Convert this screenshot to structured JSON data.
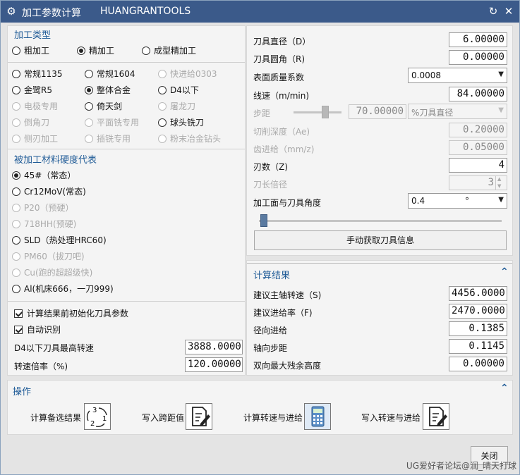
{
  "window": {
    "title": "加工参数计算",
    "brand": "HUANGRANTOOLS"
  },
  "machining_type": {
    "title": "加工类型",
    "options": [
      "粗加工",
      "精加工",
      "成型精加工"
    ],
    "selected": "精加工"
  },
  "tool_type": {
    "options": [
      {
        "label": "常规1135",
        "checked": false,
        "enabled": true
      },
      {
        "label": "常规1604",
        "checked": false,
        "enabled": true
      },
      {
        "label": "快进给0303",
        "checked": false,
        "enabled": false
      },
      {
        "label": "金鹭R5",
        "checked": false,
        "enabled": true
      },
      {
        "label": "整体合金",
        "checked": true,
        "enabled": true
      },
      {
        "label": "D4以下",
        "checked": false,
        "enabled": true
      },
      {
        "label": "电极专用",
        "checked": false,
        "enabled": false
      },
      {
        "label": "倚天剑",
        "checked": false,
        "enabled": true
      },
      {
        "label": "屠龙刀",
        "checked": false,
        "enabled": false
      },
      {
        "label": "倒角刀",
        "checked": false,
        "enabled": false
      },
      {
        "label": "平面铣专用",
        "checked": false,
        "enabled": false
      },
      {
        "label": "球头铣刀",
        "checked": false,
        "enabled": true
      },
      {
        "label": "侧刃加工",
        "checked": false,
        "enabled": false
      },
      {
        "label": "插铣专用",
        "checked": false,
        "enabled": false
      },
      {
        "label": "粉末冶金钻头",
        "checked": false,
        "enabled": false
      }
    ]
  },
  "material": {
    "title": "被加工材料硬度代表",
    "options": [
      {
        "label": "45#（常态）",
        "checked": true,
        "enabled": true
      },
      {
        "label": "Cr12MoV(常态)",
        "checked": false,
        "enabled": true
      },
      {
        "label": "P20（预硬）",
        "checked": false,
        "enabled": false
      },
      {
        "label": "718HH(预硬)",
        "checked": false,
        "enabled": false
      },
      {
        "label": "SLD（热处理HRC60)",
        "checked": false,
        "enabled": true
      },
      {
        "label": "PM60（拔刀吧)",
        "checked": false,
        "enabled": false
      },
      {
        "label": "Cu(跑的超超级快)",
        "checked": false,
        "enabled": false
      },
      {
        "label": "Al(机床666，一刀999)",
        "checked": false,
        "enabled": true
      }
    ]
  },
  "options": {
    "init_tool_params": "计算结果前初始化刀具参数",
    "init_tool_params_checked": true,
    "auto_detect": "自动识别",
    "auto_detect_checked": true,
    "max_speed_label": "D4以下刀具最高转速",
    "max_speed_value": "3888.0000",
    "speed_ratio_label": "转速倍率（%)",
    "speed_ratio_value": "120.00000"
  },
  "tool_params": {
    "diameter_label": "刀具直径（D）",
    "diameter_value": "6.00000",
    "corner_label": "刀具圆角（R)",
    "corner_value": "0.00000",
    "surface_label": "表面质量系数",
    "surface_value": "0.0008",
    "speed_label": "线速（m/min)",
    "speed_value": "84.00000",
    "stepover_label": "步距",
    "stepover_value": "70.00000",
    "stepover_unit": "%刀具直径",
    "depth_label": "切削深度（Ae)",
    "depth_value": "0.20000",
    "feed_per_tooth_label": "齿进给（mm/z)",
    "feed_per_tooth_value": "0.05000",
    "teeth_label": "刃数（Z)",
    "teeth_value": "4",
    "length_ratio_label": "刀长倍径",
    "length_ratio_value": "3",
    "angle_label": "加工面与刀具角度",
    "angle_value": "0.4",
    "angle_unit": "°",
    "fetch_button": "手动获取刀具信息"
  },
  "results": {
    "title": "计算结果",
    "spindle_label": "建议主轴转速（S)",
    "spindle_value": "4456.0000",
    "feed_label": "建议进给率（F)",
    "feed_value": "2470.0000",
    "radial_label": "径向进给",
    "radial_value": "0.1385",
    "axial_label": "轴向步距",
    "axial_value": "0.1145",
    "scallop_label": "双向最大残余高度",
    "scallop_value": "0.00000"
  },
  "actions": {
    "title": "操作",
    "items": [
      "计算备选结果",
      "写入跨距值",
      "计算转速与进给",
      "写入转速与进给"
    ],
    "close": "关闭"
  },
  "watermark": "UG爱好者论坛@润_晴天打球"
}
